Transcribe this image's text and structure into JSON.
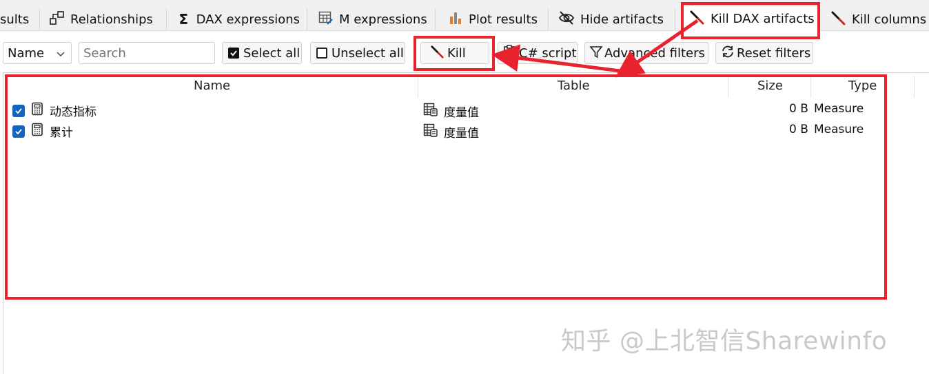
{
  "tabs": [
    {
      "label": "sults",
      "icon": "results-icon"
    },
    {
      "label": "Relationships",
      "icon": "relationships-icon"
    },
    {
      "label": "DAX expressions",
      "icon": "sigma-icon"
    },
    {
      "label": "M expressions",
      "icon": "table-edit-icon"
    },
    {
      "label": "Plot results",
      "icon": "bar-chart-icon"
    },
    {
      "label": "Hide artifacts",
      "icon": "eye-off-icon"
    },
    {
      "label": "Kill DAX artifacts",
      "icon": "knife-icon",
      "active": true
    },
    {
      "label": "Kill columns",
      "icon": "knife-icon"
    }
  ],
  "toolbar": {
    "name_dropdown": "Name",
    "search_placeholder": "Search",
    "select_all": "Select all",
    "unselect_all": "Unselect all",
    "kill": "Kill",
    "csharp_script": "C# script",
    "advanced_filters": "Advanced filters",
    "reset_filters": "Reset filters"
  },
  "grid": {
    "columns": [
      "Name",
      "Table",
      "Size",
      "Type"
    ],
    "rows": [
      {
        "checked": true,
        "name": "动态指标",
        "table": "度量值",
        "size": "0 B",
        "type": "Measure"
      },
      {
        "checked": true,
        "name": "累计",
        "table": "度量值",
        "size": "0 B",
        "type": "Measure"
      }
    ]
  },
  "colors": {
    "highlight": "#e8232e",
    "checkbox": "#1565c0"
  },
  "watermark": "知乎 @上北智信Sharewinfo"
}
